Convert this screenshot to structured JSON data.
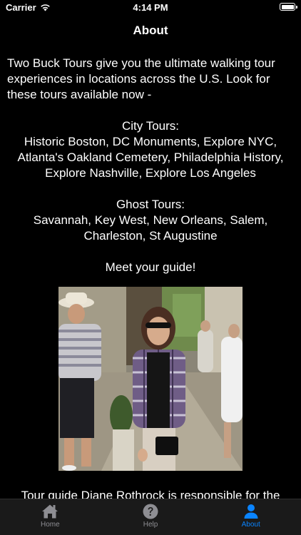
{
  "status_bar": {
    "carrier": "Carrier",
    "time": "4:14 PM"
  },
  "nav": {
    "title": "About"
  },
  "content": {
    "intro": "Two Buck Tours give you the ultimate walking tour experiences in locations across the U.S. Look for these tours available now -",
    "city_tours": {
      "heading": "City Tours:",
      "list": "Historic Boston, DC Monuments, Explore NYC, Atlanta's Oakland Cemetery, Philadelphia History, Explore Nashville, Explore Los Angeles"
    },
    "ghost_tours": {
      "heading": "Ghost Tours:",
      "list": "Savannah, Key West, New Orleans, Salem, Charleston, St Augustine"
    },
    "guide_heading": "Meet your guide!",
    "caption": "Tour guide Diane Rothrock is responsible for the research, photographs, writing, narration and"
  },
  "tabs": [
    {
      "label": "Home",
      "icon": "house-icon",
      "active": false
    },
    {
      "label": "Help",
      "icon": "question-circle-icon",
      "active": false
    },
    {
      "label": "About",
      "icon": "person-icon",
      "active": true
    }
  ],
  "colors": {
    "background": "#000000",
    "tab_bar": "#1a1a1a",
    "tab_active": "#0a84ff",
    "tab_inactive": "#8e8e93"
  }
}
